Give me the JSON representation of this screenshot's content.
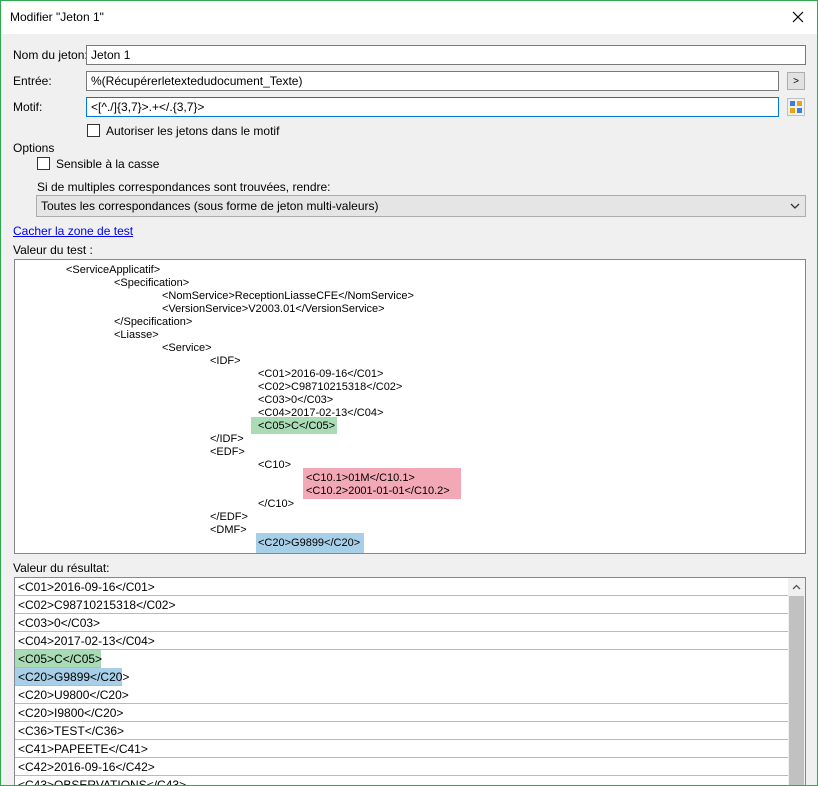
{
  "window": {
    "title": "Modifier \"Jeton 1\""
  },
  "form": {
    "name_label": "Nom du jeton:",
    "name_value": "Jeton 1",
    "input_label": "Entrée:",
    "input_value": "%(Récupérerletextedudocument_Texte)",
    "input_button": ">",
    "pattern_label": "Motif:",
    "pattern_value": "<[^./]{3,7}>.+</.{3,7}>",
    "allow_tokens_label": "Autoriser les jetons dans le motif",
    "options_label": "Options",
    "case_sensitive_label": "Sensible à la casse",
    "multiple_label": "Si de multiples correspondances sont trouvées, rendre:",
    "multiple_selected": "Toutes les correspondances (sous forme de jeton multi-valeurs)",
    "hide_test_link": "Cacher la zone de test",
    "test_value_label": "Valeur du test :",
    "result_value_label": "Valeur du résultat:"
  },
  "test_xml": [
    "<ServiceApplicatif>",
    "<Specification>",
    "<NomService>ReceptionLiasseCFE</NomService>",
    "<VersionService>V2003.01</VersionService>",
    "</Specification>",
    "<Liasse>",
    "<Service>",
    "<IDF>",
    "<C01>2016-09-16</C01>",
    "<C02>C98710215318</C02>",
    "<C03>0</C03>",
    "<C04>2017-02-13</C04>",
    "<C05>C</C05>",
    "</IDF>",
    "<EDF>",
    "<C10>",
    "<C10.1>01M</C10.1>",
    "<C10.2>2001-01-01</C10.2>",
    "</C10>",
    "</EDF>",
    "<DMF>",
    "<C20>G9899</C20>"
  ],
  "results": [
    "<C01>2016-09-16</C01>",
    "<C02>C98710215318</C02>",
    "<C03>0</C03>",
    "<C04>2017-02-13</C04>",
    "<C05>C</C05>",
    "<C20>G9899</C20>",
    "<C20>U9800</C20>",
    "<C20>I9800</C20>",
    "<C36>TEST</C36>",
    "<C41>PAPEETE</C41>",
    "<C42>2016-09-16</C42>",
    "<C43>OBSERVATIONS</C43>"
  ],
  "colors": {
    "highlight_green": "#a9dbb5",
    "highlight_red": "#f2a9b5",
    "highlight_blue": "#a7cfe8"
  }
}
